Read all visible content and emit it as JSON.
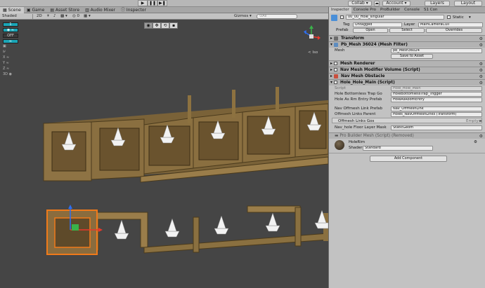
{
  "toolbar": {
    "collab": "Collab ▾",
    "account": "Account ▾",
    "layers": "Layers",
    "layout": "Layout",
    "play": "▶",
    "pause": "❚❚",
    "step": "▶❚"
  },
  "tabs": [
    "Scene",
    "Game",
    "Asset Store",
    "Audio Mixer",
    "Inspector"
  ],
  "scene_bar": {
    "shading": "Shaded",
    "mode_2d": "2D",
    "gizmos": "Gizmos ▾",
    "search_placeholder": "⊙All"
  },
  "left_tools": [
    "1",
    "◉ ≈",
    "OFF",
    "≈",
    "▣",
    "⊮",
    "X ≈",
    "Y ≈",
    "Z ≈",
    "3D ◉"
  ],
  "iso_label": "< Iso",
  "inspector": {
    "tabs": [
      "Inspector",
      "Console Pro",
      "ProBuilder",
      "Console",
      "S1 Con"
    ],
    "object_name": "00_00_Hole_singular",
    "static_label": "Static",
    "tag_label": "Tag",
    "tag_value": "Untagged",
    "layer_label": "Layer",
    "layer_value": "MainCameraCull",
    "prefab_label": "Prefab",
    "prefab_open": "Open",
    "prefab_select": "Select",
    "prefab_overrides": "Overrides",
    "transform": "Transform",
    "mesh_filter": "Pb_Mesh 36024 (Mesh Filter)",
    "mesh_label": "Mesh",
    "mesh_value": "pb_Mesh36024",
    "save_to_asset": "Save to Asset",
    "mesh_renderer": "Mesh Renderer",
    "nav_mesh_modifier": "Nav Mesh Modifier Volume (Script)",
    "nav_mesh_obstacle": "Nav Mesh Obstacle",
    "hole_main": "Hole_Hole_Main (Script)",
    "script_label": "Script",
    "script_value": "Hole_Hole_Main",
    "trap_label": "Hole Bottomless Trap Go",
    "trap_value": "HoleBottomlessTrap_Trigger",
    "entry_label": "Hole As Rm Entry Prefab",
    "entry_value": "HoleAsRoomEntry",
    "offmesh_prefab_label": "Nav Offmesh Link Prefab",
    "offmesh_prefab_value": "Nav_OffmeshLink",
    "offmesh_parent_label": "Offmesh Links Parent",
    "offmesh_parent_value": "Holes_NavOffmeshLinks (Transform)",
    "offmesh_gos_label": "Offmesh Links Gos",
    "empty_label": "Empty",
    "floor_mask_label": "Nav_hole Floor Layer Mask",
    "floor_mask_value": "StaticGeom",
    "probuilder_removed": "Pro Builder Mesh (Script) (Removed)",
    "material_name": "HoleRim",
    "shader_label": "Shader",
    "shader_value": "Standard",
    "add_component": "Add Component"
  },
  "colors": {
    "toolbar_bg": "#b7b7b7",
    "viewport_bg": "#454545",
    "selection_orange": "#f07a1a",
    "wood": "#8a7040",
    "cyan_toggle": "#1aa6b7"
  }
}
